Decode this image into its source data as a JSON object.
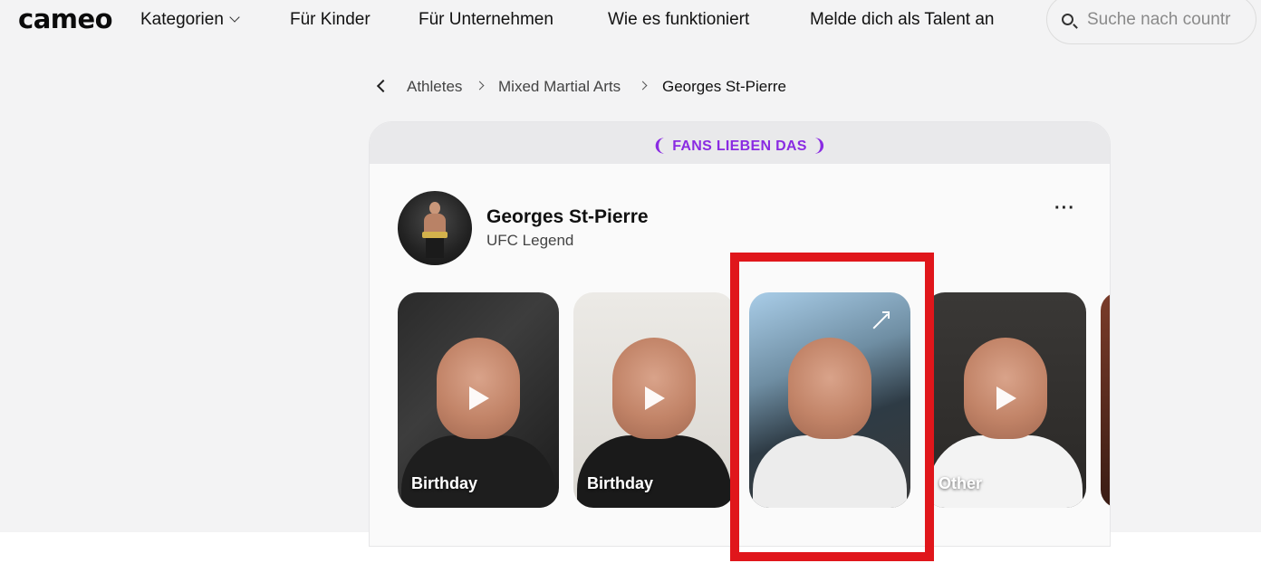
{
  "nav": {
    "logo": "cameo",
    "items": [
      {
        "label": "Kategorien",
        "has_chevron": true
      },
      {
        "label": "Für Kinder"
      },
      {
        "label": "Für Unternehmen"
      },
      {
        "label": "Wie es funktioniert"
      },
      {
        "label": "Melde dich als Talent an"
      }
    ],
    "search_placeholder": "Suche nach countr"
  },
  "breadcrumb": {
    "items": [
      "Athletes",
      "Mixed Martial Arts"
    ],
    "current": "Georges St-Pierre"
  },
  "card": {
    "banner": "FANS LIEBEN DAS",
    "profile": {
      "name": "Georges St-Pierre",
      "title": "UFC Legend"
    },
    "more_label": "···",
    "videos": [
      {
        "label": "Birthday"
      },
      {
        "label": "Birthday"
      },
      {
        "label": ""
      },
      {
        "label": "Other"
      }
    ]
  },
  "colors": {
    "accent_purple": "#8a2be2",
    "highlight_red": "#e0161b",
    "page_bg": "#f3f3f4"
  },
  "icons": [
    "chevron-down-icon",
    "search-icon",
    "back-chevron-icon",
    "laurel-icon",
    "more-icon",
    "play-icon",
    "expand-icon"
  ]
}
